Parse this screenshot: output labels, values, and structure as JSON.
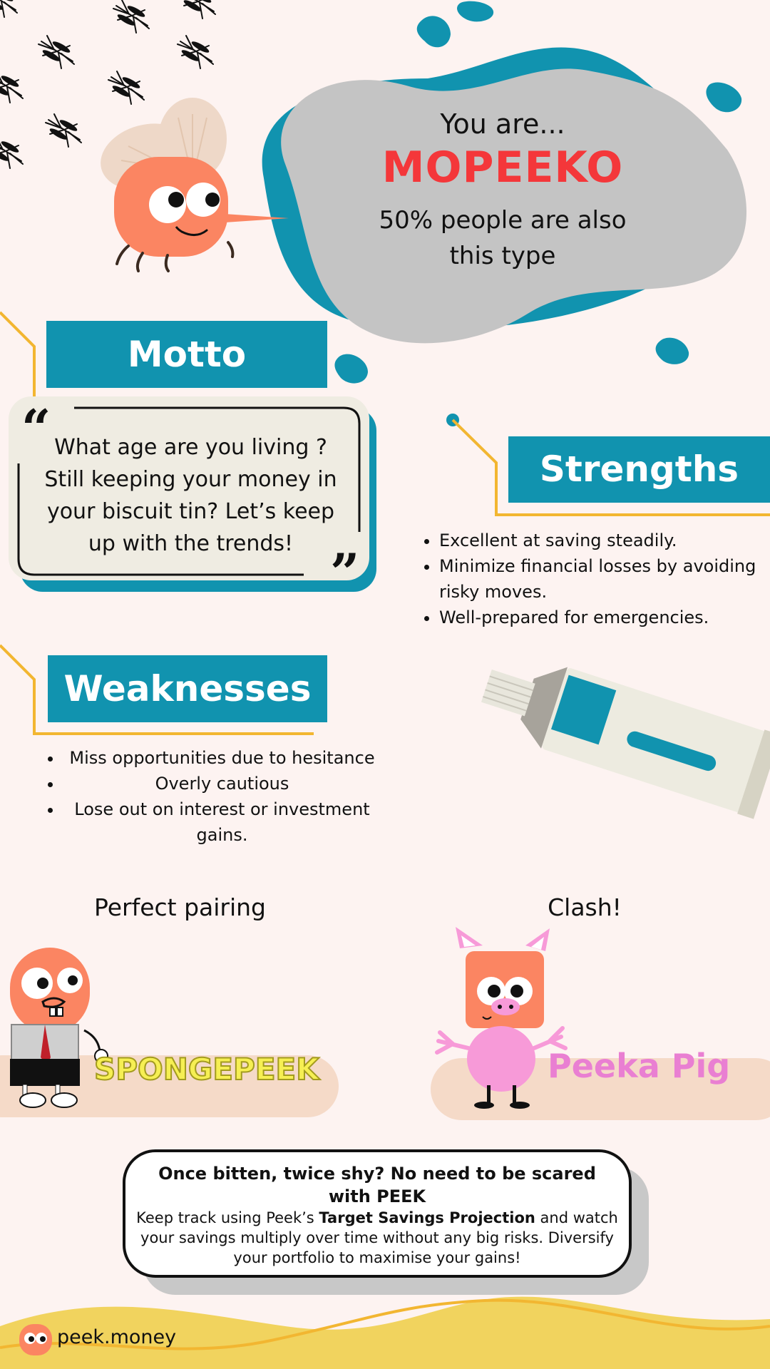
{
  "hero": {
    "intro": "You are...",
    "type_name": "MOPEEKO",
    "percent_line1": "50% people are also",
    "percent_line2": "this type"
  },
  "motto": {
    "heading": "Motto",
    "quote_line1": "What age are you living ?",
    "quote_line2": "Still keeping your money in",
    "quote_line3": "your biscuit tin? Let’s keep",
    "quote_line4": "up with  the trends!"
  },
  "strengths": {
    "heading": "Strengths",
    "items": [
      "Excellent at saving steadily.",
      "Minimize financial losses by avoiding risky moves.",
      "Well-prepared for emergencies."
    ]
  },
  "weaknesses": {
    "heading": "Weaknesses",
    "items": [
      "Miss opportunities due to hesitance",
      "Overly cautious",
      "Lose out on interest or investment gains."
    ]
  },
  "pairing": {
    "perfect_heading": "Perfect pairing",
    "perfect_name": "SPONGEPEEK",
    "clash_heading": "Clash!",
    "clash_name": "Peeka Pig"
  },
  "cta": {
    "title": "Once bitten, twice shy? No need to be scared with PEEK",
    "body_before": "Keep track using Peek’s ",
    "body_bold": "Target Savings Projection",
    "body_after": " and watch your savings multiply over time without any big risks. Diversify your portfolio to maximise your gains!"
  },
  "footer": {
    "brand": "peek.money"
  },
  "colors": {
    "background": "#fdf3f1",
    "teal": "#1193af",
    "accent_red": "#f4373a",
    "mascot_orange": "#fb8562",
    "gold_line": "#f2b631",
    "footer_yellow": "#f1d35e",
    "blob_gray": "#c4c4c4",
    "pig_pink": "#f79ad8"
  },
  "icons": [
    "mosquito-icon",
    "quote-open-icon",
    "quote-close-icon",
    "toothpaste-tube-icon",
    "peek-logo-icon"
  ]
}
